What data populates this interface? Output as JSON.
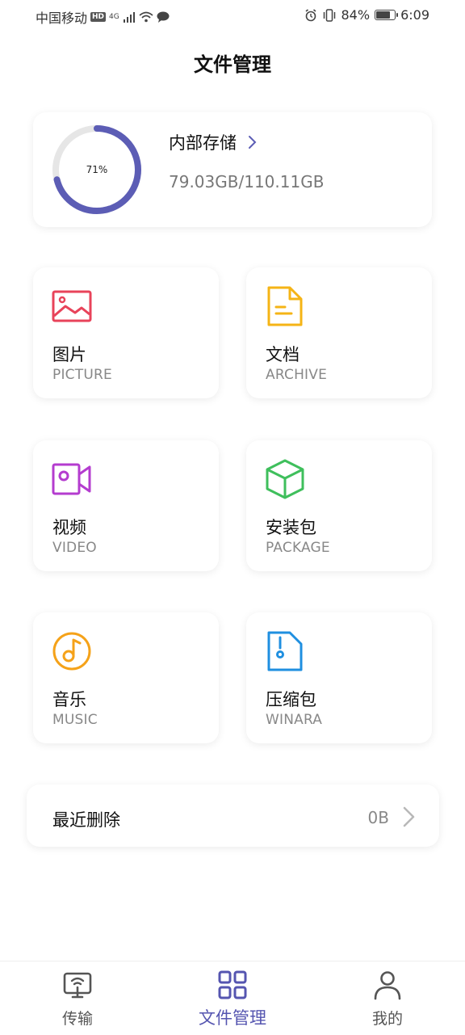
{
  "status_bar": {
    "carrier": "中国移动",
    "hd": "HD",
    "network": "4G",
    "battery_percent": "84%",
    "battery_level": 0.84,
    "time": "6:09"
  },
  "page": {
    "title": "文件管理"
  },
  "storage": {
    "percent_label": "71%",
    "percent_value": 0.71,
    "title": "内部存储",
    "size": "79.03GB/110.11GB",
    "ring_color": "#5c5db5",
    "ring_track_color": "#e6e6e6"
  },
  "categories": [
    {
      "name": "图片",
      "sub": "PICTURE",
      "icon": "picture-icon",
      "color": "#e8435a"
    },
    {
      "name": "文档",
      "sub": "ARCHIVE",
      "icon": "document-icon",
      "color": "#f5b416"
    },
    {
      "name": "视频",
      "sub": "VIDEO",
      "icon": "video-icon",
      "color": "#b43ccf"
    },
    {
      "name": "安装包",
      "sub": "PACKAGE",
      "icon": "package-box-icon",
      "color": "#3fbf5c"
    },
    {
      "name": "音乐",
      "sub": "MUSIC",
      "icon": "music-disc-icon",
      "color": "#f5a219"
    },
    {
      "name": "压缩包",
      "sub": "WINARA",
      "icon": "zip-file-icon",
      "color": "#1f8fe0"
    }
  ],
  "recent_delete": {
    "label": "最近删除",
    "value": "0B"
  },
  "bottom_nav": [
    {
      "label": "传输",
      "icon": "transfer-icon",
      "active": false
    },
    {
      "label": "文件管理",
      "icon": "grid-icon",
      "active": true
    },
    {
      "label": "我的",
      "icon": "person-icon",
      "active": false
    }
  ],
  "colors": {
    "accent": "#5555b0",
    "nav_inactive": "#555555"
  }
}
